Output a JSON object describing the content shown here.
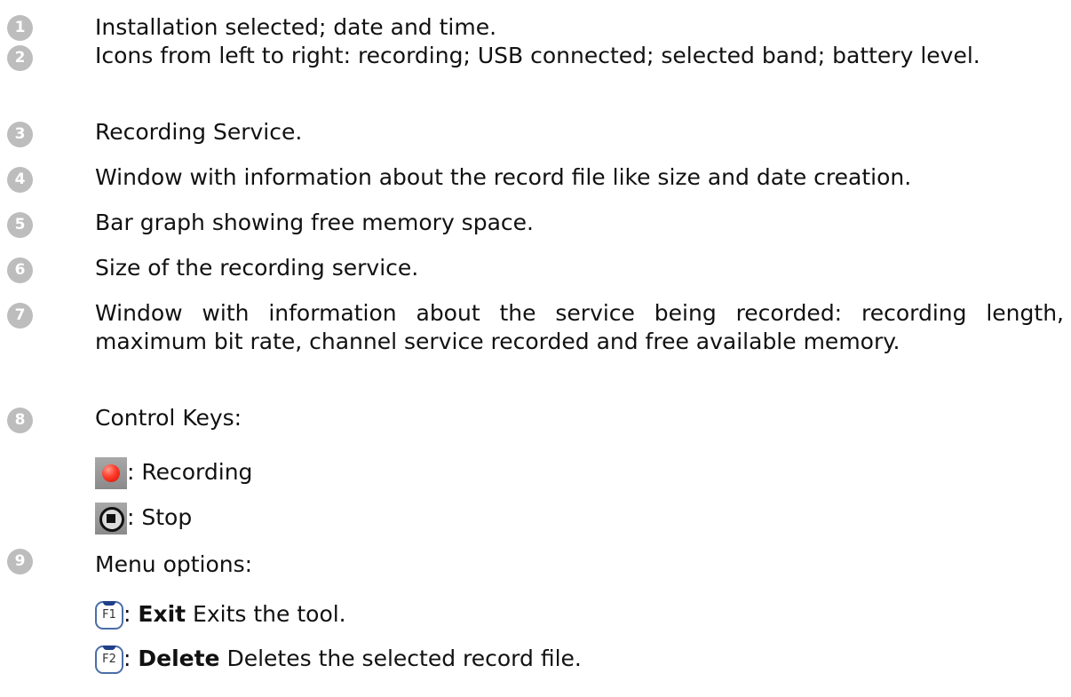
{
  "items": [
    {
      "number": "1",
      "text": "Installation selected; date and time."
    },
    {
      "number": "2",
      "text": "Icons from left to right: recording; USB connected; selected band; battery level."
    },
    {
      "number": "3",
      "text": "Recording Service."
    },
    {
      "number": "4",
      "text": "Window with information about the record file like size and date creation."
    },
    {
      "number": "5",
      "text": "Bar graph showing free memory space."
    },
    {
      "number": "6",
      "text": "Size of the recording service."
    },
    {
      "number": "7",
      "text": "Window with information about the service being recorded: recording length, maximum bit rate, channel service recorded and free available memory."
    },
    {
      "number": "8",
      "text": "Control Keys:"
    },
    {
      "number": "9",
      "text": "Menu options:"
    }
  ],
  "control_keys": [
    {
      "icon": "record-icon",
      "label": ": Recording"
    },
    {
      "icon": "stop-icon",
      "label": ": Stop"
    }
  ],
  "menu_options": [
    {
      "key_label": "F1",
      "sep": ": ",
      "name": "Exit",
      "description": " Exits the tool."
    },
    {
      "key_label": "F2",
      "sep": ": ",
      "name": "Delete",
      "description": " Deletes the selected record file."
    }
  ]
}
